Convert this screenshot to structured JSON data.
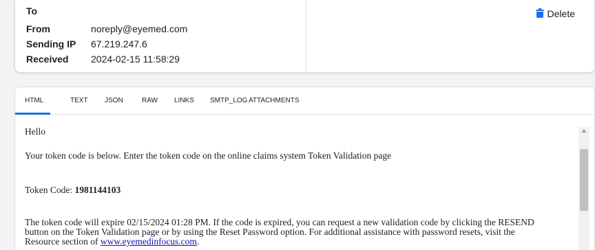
{
  "header": {
    "fields": [
      {
        "label": "To",
        "value": ""
      },
      {
        "label": "From",
        "value": "noreply@eyemed.com"
      },
      {
        "label": "Sending IP",
        "value": "67.219.247.6"
      },
      {
        "label": "Received",
        "value": "2024-02-15 11:58:29"
      }
    ],
    "delete_label": "Delete"
  },
  "tabs": [
    {
      "label": "HTML",
      "active": true
    },
    {
      "label": "TEXT"
    },
    {
      "label": "JSON"
    },
    {
      "label": "RAW"
    },
    {
      "label": "LINKS"
    },
    {
      "label": "SMTP_LOG"
    },
    {
      "label": "ATTACHMENTS"
    }
  ],
  "message": {
    "greeting": "Hello",
    "intro": "Your token code is below. Enter the token code on the online claims system Token Validation page",
    "token_label": "Token Code:",
    "token_code": "1981144103",
    "expiry_line1": "The token code will expire 02/15/2024 01:28 PM. If the code is expired, you can request a new validation code by clicking the RESEND",
    "expiry_line2": "button on the Token Validation page or by using the Reset Password option. For additional assistance with password resets, visit the",
    "expiry_line3_prefix": "Resource section of",
    "link_text": "www.eyemedinfocus.com",
    "expiry_line3_suffix": "."
  },
  "colors": {
    "accent": "#1a73e8",
    "link": "#1a0dab"
  }
}
